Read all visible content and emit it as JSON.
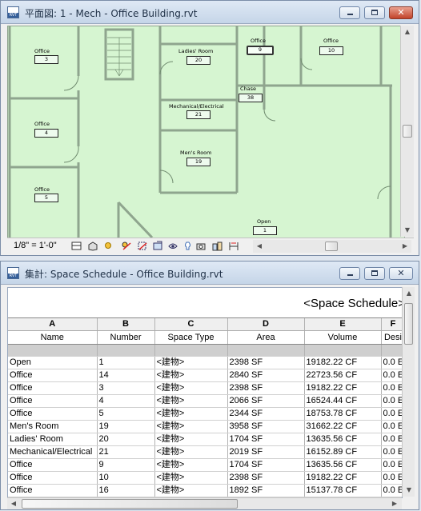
{
  "plan_window": {
    "title": "平面図: 1 - Mech - Office Building.rvt",
    "rooms": [
      {
        "name": "Office",
        "number": "3"
      },
      {
        "name": "Office",
        "number": "4"
      },
      {
        "name": "Office",
        "number": "5"
      },
      {
        "name": "Ladies' Room",
        "number": "20"
      },
      {
        "name": "Mechanical/Electrical",
        "number": "21"
      },
      {
        "name": "Men's Room",
        "number": "19"
      },
      {
        "name": "Chase",
        "number": "38"
      },
      {
        "name": "Office",
        "number": "9"
      },
      {
        "name": "Office",
        "number": "10"
      },
      {
        "name": "Open",
        "number": "1"
      }
    ],
    "view_control_bar": {
      "scale": "1/8\" = 1'-0\"",
      "icons": [
        "detail-level-icon",
        "visual-style-icon",
        "sun-path-icon",
        "shadows-icon",
        "crop-view-icon",
        "show-crop-icon",
        "unlock-3d-icon",
        "temporary-hide-icon",
        "reveal-hidden-icon",
        "worksharing-icon",
        "analysis-icon",
        "highlight-displacement-icon"
      ]
    }
  },
  "schedule_window": {
    "title": "集計: Space Schedule - Office Building.rvt",
    "schedule_title": "<Space Schedule>",
    "column_letters": [
      "A",
      "B",
      "C",
      "D",
      "E",
      "F"
    ],
    "column_headers": [
      "Name",
      "Number",
      "Space Type",
      "Area",
      "Volume",
      "Desi"
    ],
    "rows": [
      [
        "Open",
        "1",
        "<建物>",
        "2398 SF",
        "19182.22 CF",
        "0.0 E"
      ],
      [
        "Office",
        "14",
        "<建物>",
        "2840 SF",
        "22723.56 CF",
        "0.0 E"
      ],
      [
        "Office",
        "3",
        "<建物>",
        "2398 SF",
        "19182.22 CF",
        "0.0 E"
      ],
      [
        "Office",
        "4",
        "<建物>",
        "2066 SF",
        "16524.44 CF",
        "0.0 E"
      ],
      [
        "Office",
        "5",
        "<建物>",
        "2344 SF",
        "18753.78 CF",
        "0.0 E"
      ],
      [
        "Men's Room",
        "19",
        "<建物>",
        "3958 SF",
        "31662.22 CF",
        "0.0 E"
      ],
      [
        "Ladies' Room",
        "20",
        "<建物>",
        "1704 SF",
        "13635.56 CF",
        "0.0 E"
      ],
      [
        "Mechanical/Electrical",
        "21",
        "<建物>",
        "2019 SF",
        "16152.89 CF",
        "0.0 E"
      ],
      [
        "Office",
        "9",
        "<建物>",
        "1704 SF",
        "13635.56 CF",
        "0.0 E"
      ],
      [
        "Office",
        "10",
        "<建物>",
        "2398 SF",
        "19182.22 CF",
        "0.0 E"
      ],
      [
        "Office",
        "16",
        "<建物>",
        "1892 SF",
        "15137.78 CF",
        "0.0 E"
      ]
    ]
  },
  "colors": {
    "plan_background": "#d6f5d1",
    "wall": "#8fa58e",
    "title_bar": "#c5d5e8",
    "close_button": "#c2432a"
  }
}
